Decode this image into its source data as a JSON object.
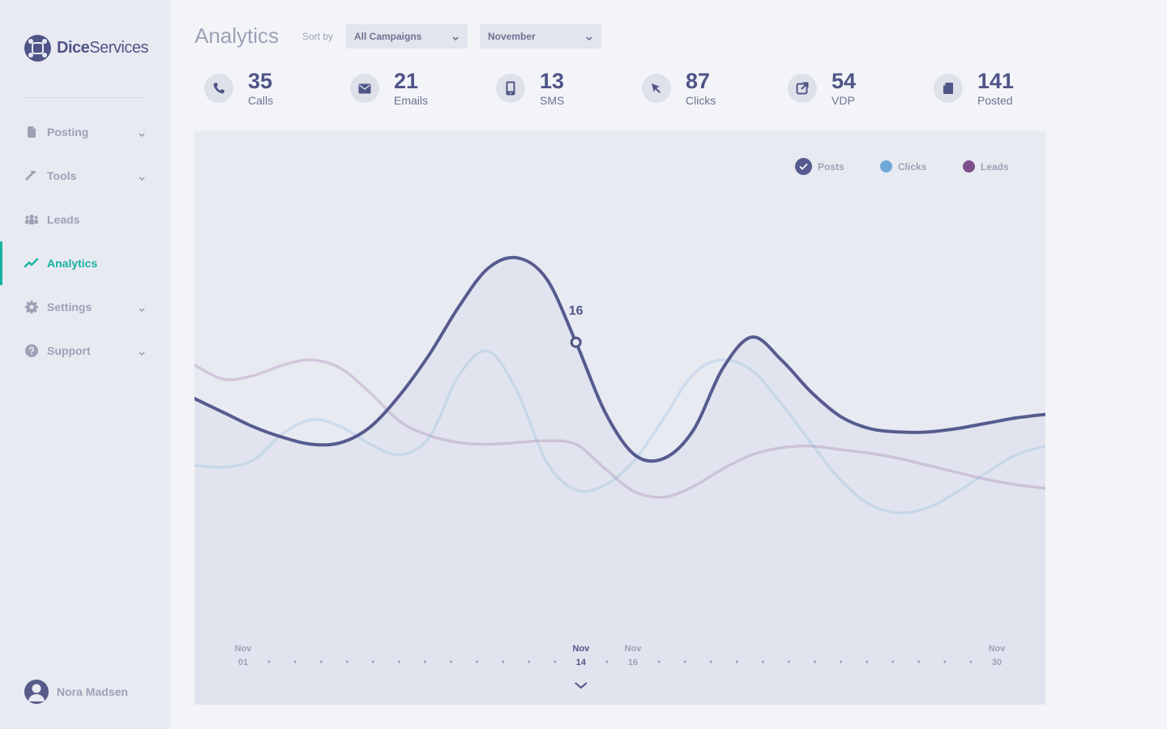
{
  "app": {
    "brand_bold": "Dice",
    "brand_light": "Services"
  },
  "sidebar": {
    "items": [
      {
        "label": "Posting",
        "icon": "document-icon",
        "has_chevron": true
      },
      {
        "label": "Tools",
        "icon": "hammer-icon",
        "has_chevron": true
      },
      {
        "label": "Leads",
        "icon": "people-icon",
        "has_chevron": false
      },
      {
        "label": "Analytics",
        "icon": "trend-icon",
        "has_chevron": false,
        "active": true
      },
      {
        "label": "Settings",
        "icon": "gear-icon",
        "has_chevron": true
      },
      {
        "label": "Support",
        "icon": "help-icon",
        "has_chevron": true
      }
    ],
    "user": {
      "name": "Nora Madsen"
    }
  },
  "header": {
    "title": "Analytics",
    "sort_label": "Sort by",
    "campaign_select": "All Campaigns",
    "month_select": "November"
  },
  "stats": [
    {
      "value": "35",
      "label": "Calls",
      "icon": "phone-icon"
    },
    {
      "value": "21",
      "label": "Emails",
      "icon": "envelope-icon"
    },
    {
      "value": "13",
      "label": "SMS",
      "icon": "mobile-icon"
    },
    {
      "value": "87",
      "label": "Clicks",
      "icon": "cursor-icon"
    },
    {
      "value": "54",
      "label": "VDP",
      "icon": "external-link-icon"
    },
    {
      "value": "141",
      "label": "Posted",
      "icon": "document-icon"
    }
  ],
  "colors": {
    "primary": "#4f5587",
    "accent": "#17b39e",
    "posts": "#565b8f",
    "clicks": "#6fa8d6",
    "leads": "#7e4e8c",
    "muted": "#9ea1b5"
  },
  "chart_data": {
    "type": "line",
    "x": [
      "Nov 01",
      "Nov 02",
      "Nov 03",
      "Nov 04",
      "Nov 05",
      "Nov 06",
      "Nov 07",
      "Nov 08",
      "Nov 09",
      "Nov 10",
      "Nov 11",
      "Nov 12",
      "Nov 13",
      "Nov 14",
      "Nov 15",
      "Nov 16",
      "Nov 17",
      "Nov 18",
      "Nov 19",
      "Nov 20",
      "Nov 21",
      "Nov 22",
      "Nov 23",
      "Nov 24",
      "Nov 25",
      "Nov 26",
      "Nov 27",
      "Nov 28",
      "Nov 29",
      "Nov 30"
    ],
    "x_labels_shown": [
      {
        "month": "Nov",
        "day": "01"
      },
      {
        "month": "Nov",
        "day": "14",
        "selected": true
      },
      {
        "month": "Nov",
        "day": "16"
      },
      {
        "month": "Nov",
        "day": "30"
      }
    ],
    "series": [
      {
        "name": "Posts",
        "color": "#565b8f",
        "highlight": true,
        "values": [
          12.8,
          12.0,
          11.2,
          10.6,
          10.2,
          10.3,
          11.2,
          13.0,
          15.3,
          18.0,
          20.2,
          20.8,
          19.6,
          16.0,
          12.0,
          9.6,
          9.4,
          11.0,
          14.5,
          16.3,
          15.0,
          13.2,
          11.8,
          11.1,
          10.9,
          10.9,
          11.1,
          11.4,
          11.7,
          11.9
        ]
      },
      {
        "name": "Clicks",
        "color": "#6fa8d6",
        "values": [
          9.0,
          8.9,
          9.3,
          10.8,
          11.6,
          11.2,
          10.2,
          9.6,
          10.6,
          14.1,
          15.5,
          13.2,
          9.2,
          7.6,
          7.9,
          9.3,
          11.7,
          14.2,
          15.0,
          14.4,
          12.5,
          10.3,
          8.2,
          6.8,
          6.3,
          6.6,
          7.5,
          8.6,
          9.6,
          10.1
        ]
      },
      {
        "name": "Leads",
        "color": "#7e4e8c",
        "values": [
          14.7,
          13.9,
          14.1,
          14.7,
          15.0,
          14.5,
          13.1,
          11.5,
          10.7,
          10.3,
          10.2,
          10.3,
          10.4,
          10.2,
          8.8,
          7.5,
          7.2,
          7.8,
          8.8,
          9.6,
          10.0,
          10.1,
          9.9,
          9.7,
          9.4,
          9.0,
          8.6,
          8.2,
          7.9,
          7.7
        ]
      }
    ],
    "selected_point": {
      "series": "Posts",
      "x": "Nov 14",
      "value": 16
    },
    "ylim": [
      0,
      28
    ],
    "grid": false,
    "legend_position": "top-right",
    "legend": [
      "Posts",
      "Clicks",
      "Leads"
    ]
  }
}
